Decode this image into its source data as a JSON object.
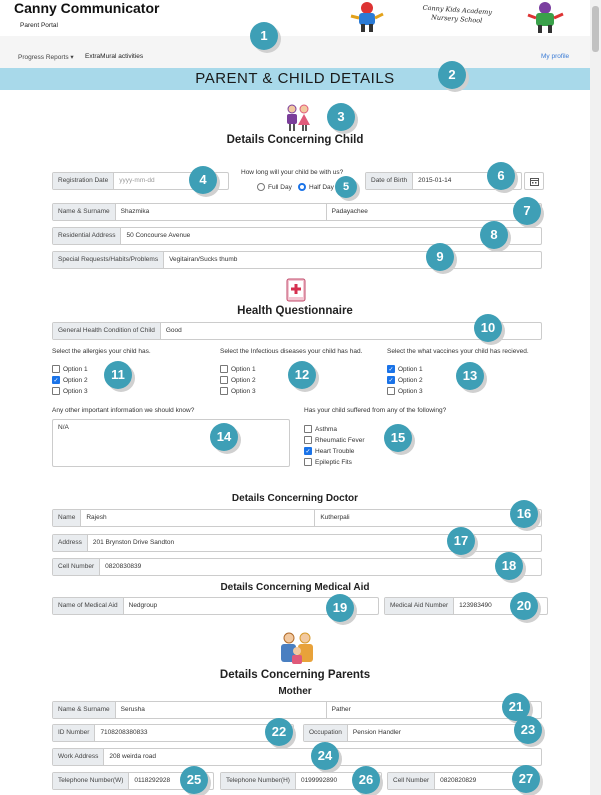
{
  "app": {
    "title": "Canny Communicator",
    "subtitle": "Parent Portal",
    "logo_text": "Canny Kids Academy Nursery School"
  },
  "nav": {
    "progress_reports": "Progress Reports",
    "extramural": "ExtraMural activities",
    "my_profile": "My profile"
  },
  "banner": "PARENT & CHILD DETAILS",
  "child": {
    "heading": "Details Concerning Child",
    "registration_date": {
      "label": "Registration Date",
      "placeholder": "yyyy-mm-dd"
    },
    "stay_question": "How long will your child be with us?",
    "stay_options": [
      "Full Day",
      "Half Day"
    ],
    "stay_selected": "Half Day",
    "dob": {
      "label": "Date of Birth",
      "value": "2015-01-14"
    },
    "name": {
      "label": "Name & Surname",
      "first": "Shazmika",
      "last": "Padayachee"
    },
    "address": {
      "label": "Residential Address",
      "value": "50 Concourse Avenue"
    },
    "special": {
      "label": "Special Requests/Habits/Problems",
      "value": "Vegitairan/Sucks thumb"
    }
  },
  "health": {
    "heading": "Health Questionnaire",
    "general": {
      "label": "General Health Condition of Child",
      "value": "Good"
    },
    "allergies": {
      "question": "Select the allergies your child has.",
      "options": [
        "Option 1",
        "Option 2",
        "Option 3"
      ],
      "checked": [
        false,
        true,
        false
      ]
    },
    "infectious": {
      "question": "Select the Infectious diseases your child has had.",
      "options": [
        "Option 1",
        "Option 2",
        "Option 3"
      ],
      "checked": [
        false,
        false,
        false
      ]
    },
    "vaccines": {
      "question": "Select the what vaccines your child has recieved.",
      "options": [
        "Option 1",
        "Option 2",
        "Option 3"
      ],
      "checked": [
        true,
        true,
        false
      ]
    },
    "other_question": "Any other important information we should know?",
    "other_value": "N/A",
    "conditions_question": "Has your child suffered from any of the following?",
    "conditions": [
      "Asthma",
      "Rheumatic Fever",
      "Heart Trouble",
      "Epileptic Fits"
    ],
    "conditions_checked": [
      false,
      false,
      true,
      false
    ]
  },
  "doctor": {
    "heading": "Details Concerning Doctor",
    "name": {
      "label": "Name",
      "first": "Rajesh",
      "last": "Kutherpali"
    },
    "address": {
      "label": "Address",
      "value": "201 Brynston Drive Sandton"
    },
    "cell": {
      "label": "Cell Number",
      "value": "0820830839"
    }
  },
  "medical_aid": {
    "heading": "Details Concerning Medical Aid",
    "name": {
      "label": "Name of Medical Aid",
      "value": "Nedgroup"
    },
    "number": {
      "label": "Medical Aid Number",
      "value": "123983490"
    }
  },
  "parents": {
    "heading": "Details Concerning Parents",
    "mother_heading": "Mother",
    "name": {
      "label": "Name & Surname",
      "first": "Serusha",
      "last": "Pather"
    },
    "id": {
      "label": "ID Number",
      "value": "7108208380833"
    },
    "occupation": {
      "label": "Occupation",
      "value": "Pension Handler"
    },
    "work_address": {
      "label": "Work Address",
      "value": "208 weirda road"
    },
    "tel_w": {
      "label": "Telephone Number(W)",
      "value": "0118292928"
    },
    "tel_h": {
      "label": "Telephone Number(H)",
      "value": "0199992890"
    },
    "cell": {
      "label": "Cell Number",
      "value": "0820820829"
    }
  },
  "badges": [
    "1",
    "2",
    "3",
    "4",
    "5",
    "6",
    "7",
    "8",
    "9",
    "10",
    "11",
    "12",
    "13",
    "14",
    "15",
    "16",
    "17",
    "18",
    "19",
    "20",
    "21",
    "22",
    "23",
    "24",
    "25",
    "26",
    "27"
  ],
  "colors": {
    "banner": "#a8d9ea",
    "badge": "#3e9fb6",
    "check": "#1a73e8"
  }
}
